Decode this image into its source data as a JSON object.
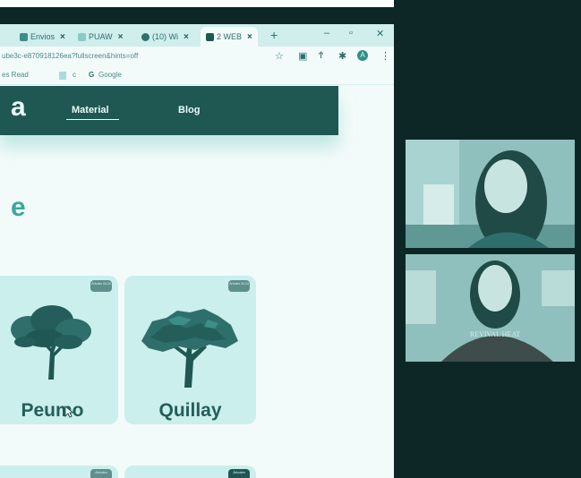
{
  "tabs": [
    {
      "label": "Envios",
      "active": false
    },
    {
      "label": "PUAW",
      "active": false
    },
    {
      "label": "(10) Wi",
      "active": false
    },
    {
      "label": "2 WEB",
      "active": true
    }
  ],
  "new_tab": "+",
  "window_controls": {
    "minimize": "–",
    "maximize": "▫",
    "close": "✕"
  },
  "address": {
    "url": "ube3c-e870918126ea?fullscreen&hints=off",
    "profile_initial": "A"
  },
  "bookmarks": [
    {
      "label": "es Read"
    },
    {
      "label": "c"
    },
    {
      "label": "Google"
    }
  ],
  "site": {
    "logo": "a",
    "nav": [
      {
        "label": "Material"
      },
      {
        "label": "Blog"
      }
    ],
    "heading": "e"
  },
  "cards": [
    {
      "label": "Peumo",
      "badge": "Árboles\n00:24"
    },
    {
      "label": "Quillay",
      "badge": "Árboles\n00:24"
    }
  ],
  "lower_badges": [
    "Árboles",
    "Árboles"
  ],
  "video_tiles": [
    {
      "label": "participant-1"
    },
    {
      "label": "participant-2",
      "shirt_text": "REVIVAL HEAT"
    }
  ],
  "colors": {
    "nav_bg": "#1f5752",
    "card_bg": "#cbefec",
    "page_bg": "#f3fbfa",
    "dark_stage": "#0d2727",
    "accent": "#3aa8a0"
  }
}
